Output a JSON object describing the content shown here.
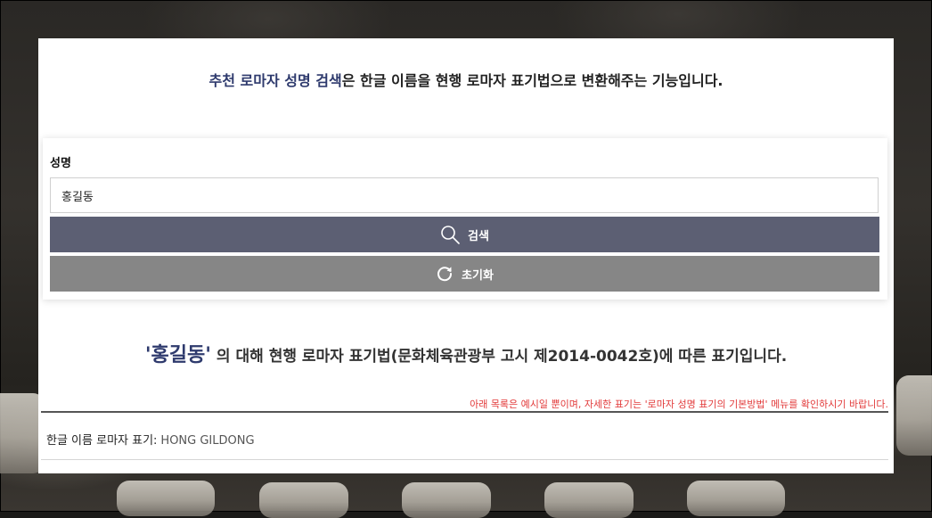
{
  "intro": {
    "accent": "추천 로마자 성명 검색",
    "rest": "은 한글 이름을 현행 로마자 표기법으로 변환해주는 기능입니다."
  },
  "form": {
    "name_label": "성명",
    "name_value": "홍길동",
    "search_label": "검색",
    "reset_label": "초기화"
  },
  "result": {
    "quoted_name": "'홍길동'",
    "description": " 의 대해 현행 로마자 표기법(문화체육관광부 고시 제2014-0042호)에 따른 표기입니다.",
    "notice": "아래 목록은 예시일 뿐이며, 자세한 표기는 '로마자 성명 표기의 기본방법' 메뉴를 확인하시기 바랍니다.",
    "row_label": "한글  이름  로마자  표기:",
    "row_value": "HONG  GILDONG"
  },
  "colors": {
    "accent": "#2e3a6d",
    "search_button": "#5c5f73",
    "reset_button": "#868686",
    "notice": "#e23a3a"
  },
  "icons": {
    "search": "search-icon",
    "reset": "refresh-icon"
  }
}
